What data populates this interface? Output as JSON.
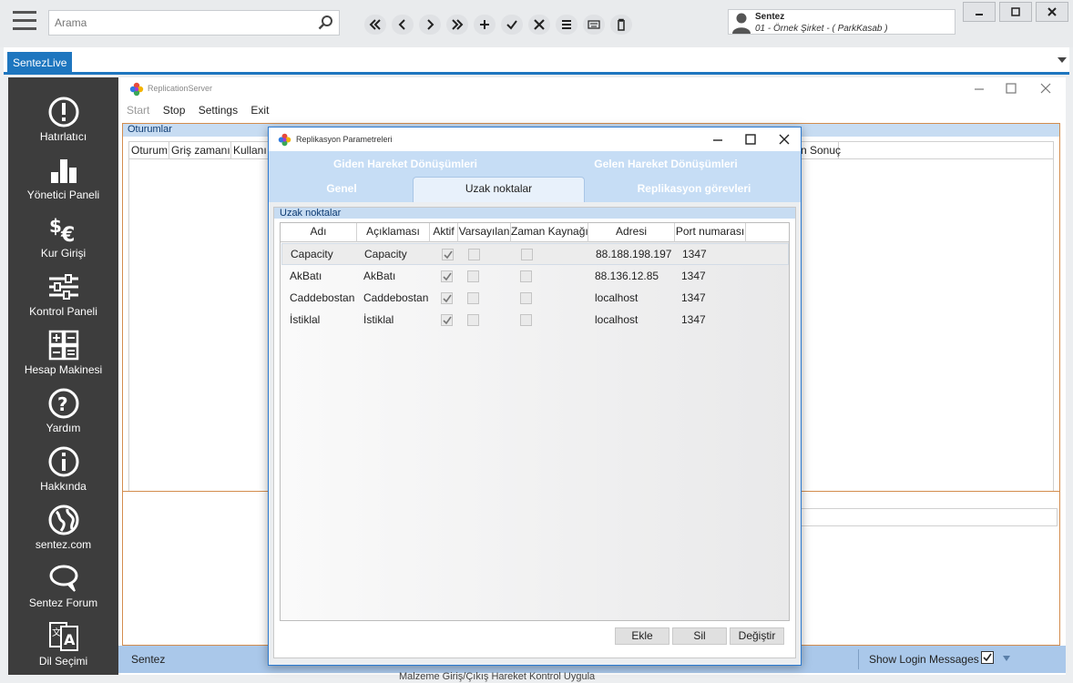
{
  "search": {
    "placeholder": "Arama"
  },
  "user": {
    "name": "Sentez",
    "company": "01 - Örnek Şirket - ( ParkKasab )"
  },
  "toolbar": {
    "buttons": [
      "first-icon",
      "prev-icon",
      "next-icon",
      "last-icon",
      "add-icon",
      "save-check-icon",
      "cancel-x-icon",
      "list-icon",
      "keyboard-icon",
      "delete-trash-icon"
    ]
  },
  "tabs": {
    "active": "SentezLive"
  },
  "sidebar": {
    "items": [
      {
        "label": "Hatırlatıcı",
        "icon": "alert-icon"
      },
      {
        "label": "Yönetici Paneli",
        "icon": "bar-chart-icon"
      },
      {
        "label": "Kur Girişi",
        "icon": "currency-icon"
      },
      {
        "label": "Kontrol Paneli",
        "icon": "sliders-icon"
      },
      {
        "label": "Hesap Makinesi",
        "icon": "calculator-icon"
      },
      {
        "label": "Yardım",
        "icon": "help-icon"
      },
      {
        "label": "Hakkında",
        "icon": "info-icon"
      },
      {
        "label": "sentez.com",
        "icon": "globe-icon"
      },
      {
        "label": "Sentez Forum",
        "icon": "forum-icon"
      },
      {
        "label": "Dil Seçimi",
        "icon": "language-icon"
      }
    ]
  },
  "replication_server": {
    "title": "ReplicationServer",
    "menu": {
      "start": "Start",
      "stop": "Stop",
      "settings": "Settings",
      "exit": "Exit"
    },
    "sessions_header": "Oturumlar",
    "session_columns": [
      "Oturum",
      "Griş zamanı",
      "Kullanı",
      "n",
      "Sonuç"
    ],
    "status_left": "Sentez",
    "status_right": "Show Login Messages",
    "show_login_messages": true
  },
  "dialog": {
    "title": "Replikasyon Parametreleri",
    "tabs": {
      "giden": "Giden Hareket Dönüşümleri",
      "gelen": "Gelen Hareket Dönüşümleri",
      "genel": "Genel",
      "uzak": "Uzak noktalar",
      "replikasyon": "Replikasyon görevleri"
    },
    "group_header": "Uzak noktalar",
    "columns": {
      "adi": "Adı",
      "aciklamasi": "Açıklaması",
      "aktif": "Aktif",
      "varsayilan": "Varsayılan",
      "zaman": "Zaman Kaynağı",
      "adresi": "Adresi",
      "port": "Port numarası"
    },
    "rows": [
      {
        "adi": "Capacity",
        "aciklamasi": "Capacity",
        "aktif": true,
        "varsayilan": false,
        "zaman": false,
        "adresi": "88.188.198.197",
        "port": "1347"
      },
      {
        "adi": "AkBatı",
        "aciklamasi": "AkBatı",
        "aktif": true,
        "varsayilan": false,
        "zaman": false,
        "adresi": "88.136.12.85",
        "port": "1347"
      },
      {
        "adi": "Caddebostan",
        "aciklamasi": "Caddebostan",
        "aktif": true,
        "varsayilan": false,
        "zaman": false,
        "adresi": "localhost",
        "port": "1347"
      },
      {
        "adi": "İstiklal",
        "aciklamasi": "İstiklal",
        "aktif": true,
        "varsayilan": false,
        "zaman": false,
        "adresi": "localhost",
        "port": "1347"
      }
    ],
    "buttons": {
      "ekle": "Ekle",
      "sil": "Sil",
      "degistir": "Değiştir"
    }
  },
  "footer_ghost": "Malzeme Giriş/Çıkış Hareket Kontrol Uygula"
}
